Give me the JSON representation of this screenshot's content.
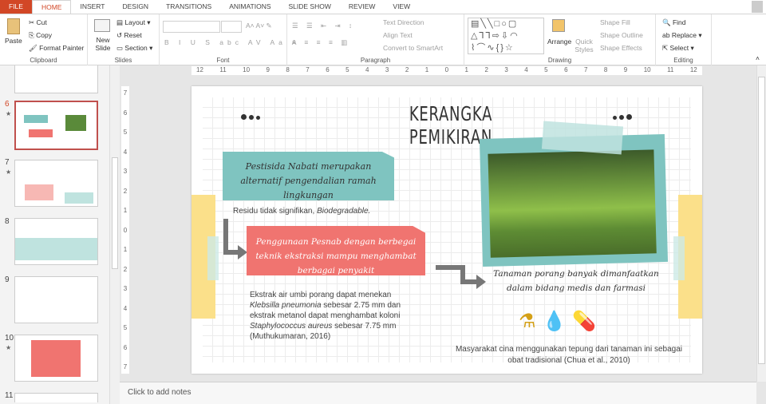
{
  "tabs": [
    "FILE",
    "HOME",
    "INSERT",
    "DESIGN",
    "TRANSITIONS",
    "ANIMATIONS",
    "SLIDE SHOW",
    "REVIEW",
    "VIEW"
  ],
  "ribbon": {
    "clipboard": {
      "label": "Clipboard",
      "paste": "Paste",
      "cut": "Cut",
      "copy": "Copy",
      "format_painter": "Format Painter"
    },
    "slides": {
      "label": "Slides",
      "new_slide": "New Slide",
      "layout": "Layout",
      "reset": "Reset",
      "section": "Section"
    },
    "font": {
      "label": "Font"
    },
    "paragraph": {
      "label": "Paragraph",
      "text_direction": "Text Direction",
      "align_text": "Align Text",
      "convert": "Convert to SmartArt"
    },
    "drawing": {
      "label": "Drawing",
      "arrange": "Arrange",
      "quick_styles": "Quick Styles",
      "shape_fill": "Shape Fill",
      "shape_outline": "Shape Outline",
      "shape_effects": "Shape Effects"
    },
    "editing": {
      "label": "Editing",
      "find": "Find",
      "replace": "Replace",
      "select": "Select"
    }
  },
  "thumbnails": [
    {
      "num": "6",
      "selected": true,
      "star": true
    },
    {
      "num": "7",
      "star": true
    },
    {
      "num": "8"
    },
    {
      "num": "9"
    },
    {
      "num": "10",
      "star": true
    },
    {
      "num": "11"
    }
  ],
  "slide": {
    "title": "KERANGKA PEMIKIRAN",
    "teal_box": "Pestisida Nabati merupakan alternatif pengendalian ramah lingkungan",
    "residu": "Residu tidak signifikan, ",
    "residu_italic": "Biodegradable.",
    "red_box": "Penggunaan Pesnab dengan berbegai teknik ekstraksi mampu menghambat berbagai penyakit",
    "extract": {
      "l1": "Ekstrak air umbi porang dapat menekan",
      "l2_i": "Klebsilla pneumonia",
      "l2": " sebesar 2.75 mm dan",
      "l3": "ekstrak metanol dapat menghambat koloni",
      "l4_i": "Staphylococcus aureus",
      "l4": " sebesar  7.75 mm",
      "l5": "(Muthukumaran, 2016)"
    },
    "caption": "Tanaman porang banyak dimanfaatkan dalam bidang medis dan farmasi",
    "bottom": "Masyarakat cina menggunakan tepung dari tanaman ini sebagai obat tradisional (Chua et al., 2010)"
  },
  "notes_placeholder": "Click to add notes",
  "colors": {
    "accent": "#d24726",
    "teal": "#7fc4c0",
    "red": "#f07470",
    "yellow": "#fbe08a",
    "gold": "#d4a017"
  }
}
